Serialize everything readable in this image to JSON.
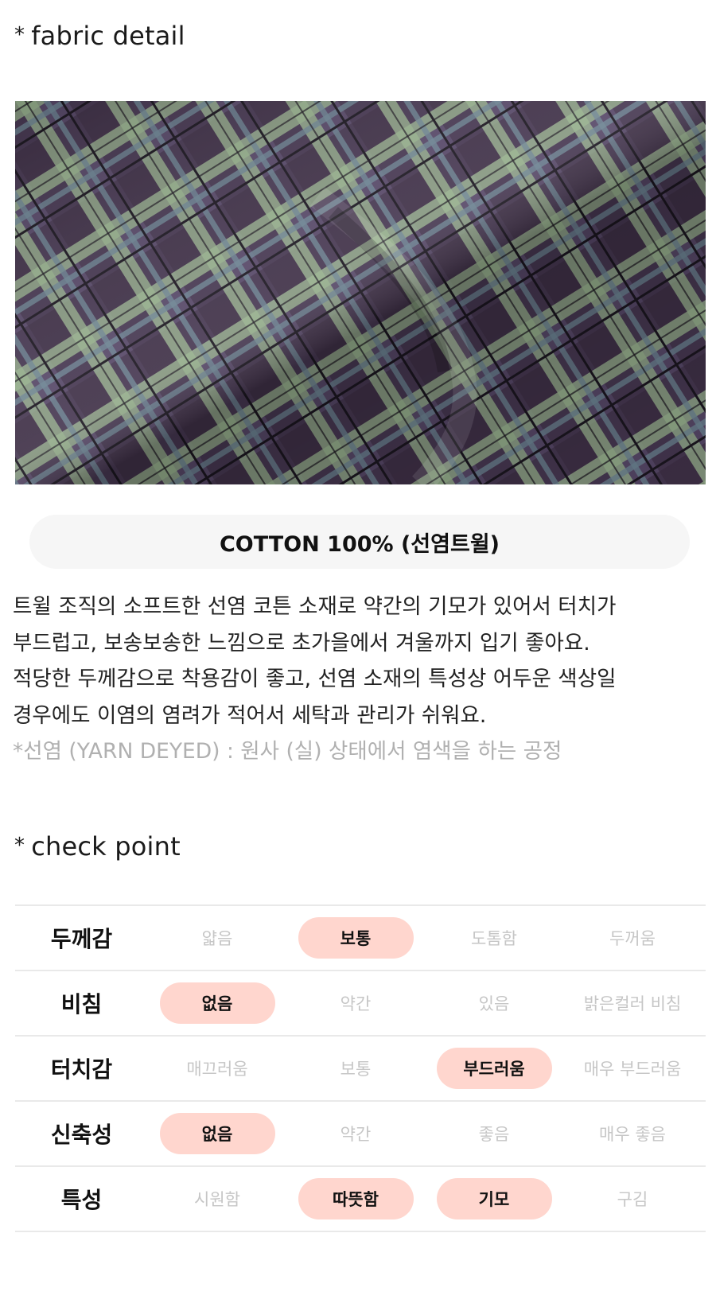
{
  "fabric_section": {
    "star": "*",
    "title": "fabric detail",
    "photo": {
      "icon": "plaid-fabric-photo",
      "colors": {
        "base": "#574868",
        "dark": "#3a2c40",
        "green": "#98b48e",
        "blue": "#6d8594"
      }
    },
    "material": "COTTON 100% (선염트윌)",
    "description": [
      "트윌 조직의 소프트한 선염 코튼 소재로 약간의 기모가 있어서 터치가",
      "부드럽고, 보송보송한 느낌으로 초가을에서 겨울까지 입기 좋아요.",
      "적당한 두께감으로 착용감이 좋고, 선염 소재의 특성상 어두운 색상일",
      "경우에도 이염의 염려가 적어서 세탁과 관리가 쉬워요."
    ],
    "note": "*선염 (YARN DEYED) : 원사 (실) 상태에서 염색을 하는 공정"
  },
  "check_section": {
    "star": "*",
    "title": "check point",
    "highlight_color": "#ffd6ce",
    "rows": [
      {
        "label": "두께감",
        "options": [
          "얇음",
          "보통",
          "도톰함",
          "두꺼움"
        ],
        "selected": [
          1
        ]
      },
      {
        "label": "비침",
        "options": [
          "없음",
          "약간",
          "있음",
          "밝은컬러 비침"
        ],
        "selected": [
          0
        ]
      },
      {
        "label": "터치감",
        "options": [
          "매끄러움",
          "보통",
          "부드러움",
          "매우 부드러움"
        ],
        "selected": [
          2
        ]
      },
      {
        "label": "신축성",
        "options": [
          "없음",
          "약간",
          "좋음",
          "매우 좋음"
        ],
        "selected": [
          0
        ]
      },
      {
        "label": "특성",
        "options": [
          "시원함",
          "따뜻함",
          "기모",
          "구김"
        ],
        "selected": [
          1,
          2
        ]
      }
    ]
  }
}
